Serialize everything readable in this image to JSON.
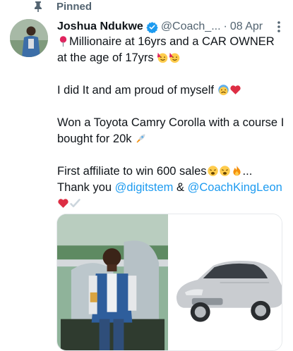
{
  "pinned": {
    "label": "Pinned"
  },
  "author": {
    "name": "Joshua Ndukwe",
    "handle": "@Coach_...",
    "date": "08 Apr"
  },
  "tweet": {
    "line1": "Millionaire at 16yrs and a CAR OWNER at the age of 17yrs",
    "line2": "I did It and am proud of myself",
    "line3": "Won a Toyota Camry Corolla with a course I bought for 20k",
    "line4": "First affiliate to win 600 sales",
    "line4_tail": "...",
    "thank_prefix": "Thank you",
    "mention1": "@digitstem",
    "amp": "&",
    "mention2": "@CoachKingLeon"
  },
  "icons": {
    "pin": "pin-icon",
    "verified": "verified-badge-icon",
    "more": "more-vertical-icon"
  },
  "colors": {
    "link": "#1d9bf0",
    "secondary_text": "#536471",
    "verified": "#1d9bf0"
  }
}
